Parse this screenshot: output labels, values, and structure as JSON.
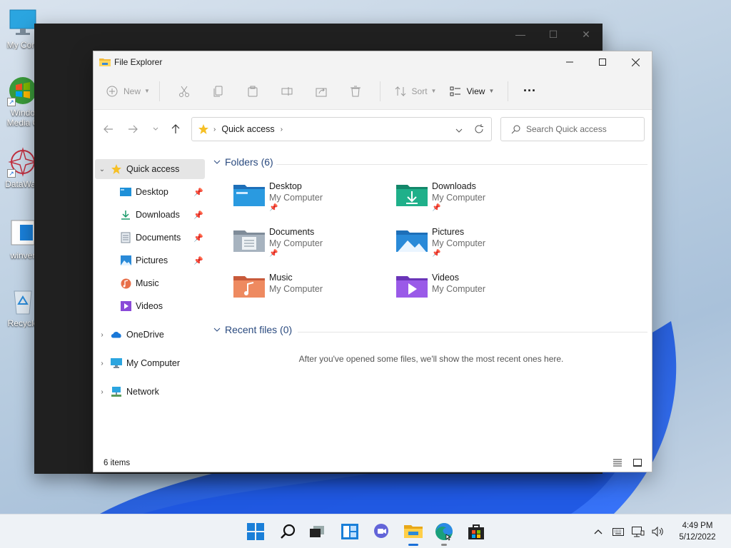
{
  "desktop": {
    "icons": [
      {
        "label": "My Com"
      },
      {
        "label": "Windo Media C"
      },
      {
        "label": "DataWag"
      },
      {
        "label": "winver"
      },
      {
        "label": "Recycle"
      }
    ]
  },
  "window": {
    "title": "File Explorer"
  },
  "commandbar": {
    "new_label": "New",
    "sort_label": "Sort",
    "view_label": "View",
    "more_label": "···"
  },
  "address": {
    "location": "Quick access",
    "search_placeholder": "Search Quick access"
  },
  "sidebar": {
    "quick_access": "Quick access",
    "items": [
      {
        "label": "Desktop",
        "pinned": true
      },
      {
        "label": "Downloads",
        "pinned": true
      },
      {
        "label": "Documents",
        "pinned": true
      },
      {
        "label": "Pictures",
        "pinned": true
      },
      {
        "label": "Music",
        "pinned": false
      },
      {
        "label": "Videos",
        "pinned": false
      }
    ],
    "onedrive": "OneDrive",
    "my_computer": "My Computer",
    "network": "Network"
  },
  "content": {
    "folders_heading": "Folders (6)",
    "folders": [
      {
        "name": "Desktop",
        "location": "My Computer"
      },
      {
        "name": "Downloads",
        "location": "My Computer"
      },
      {
        "name": "Documents",
        "location": "My Computer"
      },
      {
        "name": "Pictures",
        "location": "My Computer"
      },
      {
        "name": "Music",
        "location": "My Computer"
      },
      {
        "name": "Videos",
        "location": "My Computer"
      }
    ],
    "recent_heading": "Recent files (0)",
    "recent_empty": "After you've opened some files, we'll show the most recent ones here."
  },
  "status": {
    "item_count": "6 items"
  },
  "taskbar": {
    "time": "4:49 PM",
    "date": "5/12/2022"
  }
}
